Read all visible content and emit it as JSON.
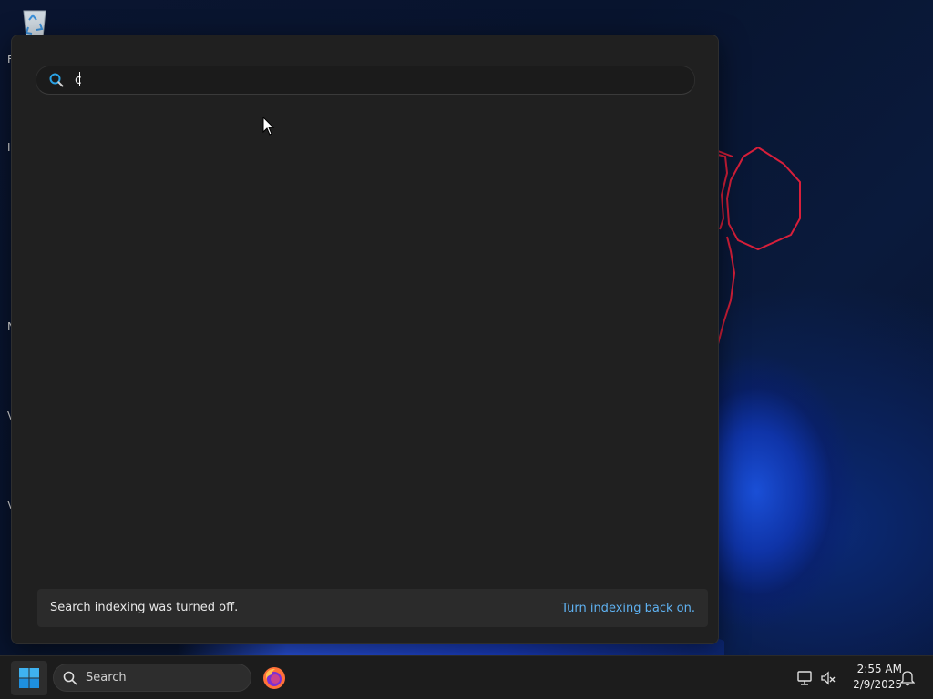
{
  "search": {
    "query": "c"
  },
  "indexing": {
    "message": "Search indexing was turned off.",
    "link": "Turn indexing back on."
  },
  "taskbar": {
    "search_label": "Search",
    "time": "2:55 AM",
    "date": "2/9/2025"
  },
  "desktop": {
    "label_fragments": [
      "R",
      "I",
      "N",
      "V",
      "V"
    ]
  },
  "colors": {
    "panel_bg": "#202020",
    "link": "#5fb2f2",
    "accent": "#1a8ad4"
  }
}
